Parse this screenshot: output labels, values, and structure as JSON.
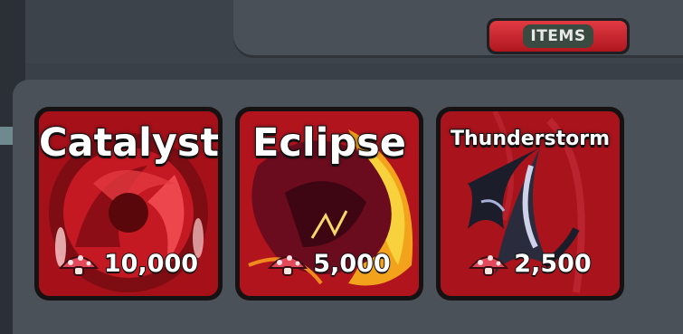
{
  "header": {
    "items_button_label": "ITEMS"
  },
  "cards": [
    {
      "name": "Catalyst",
      "price": "10,000",
      "currency_icon": "mushroom-icon"
    },
    {
      "name": "Eclipse",
      "price": "5,000",
      "currency_icon": "mushroom-icon"
    },
    {
      "name": "Thunderstorm",
      "price": "2,500",
      "currency_icon": "mushroom-icon"
    }
  ],
  "colors": {
    "card_red": "#b3151d",
    "card_dark_red": "#6e0a0f",
    "button_red": "#d92b35",
    "background": "#3a4048"
  }
}
